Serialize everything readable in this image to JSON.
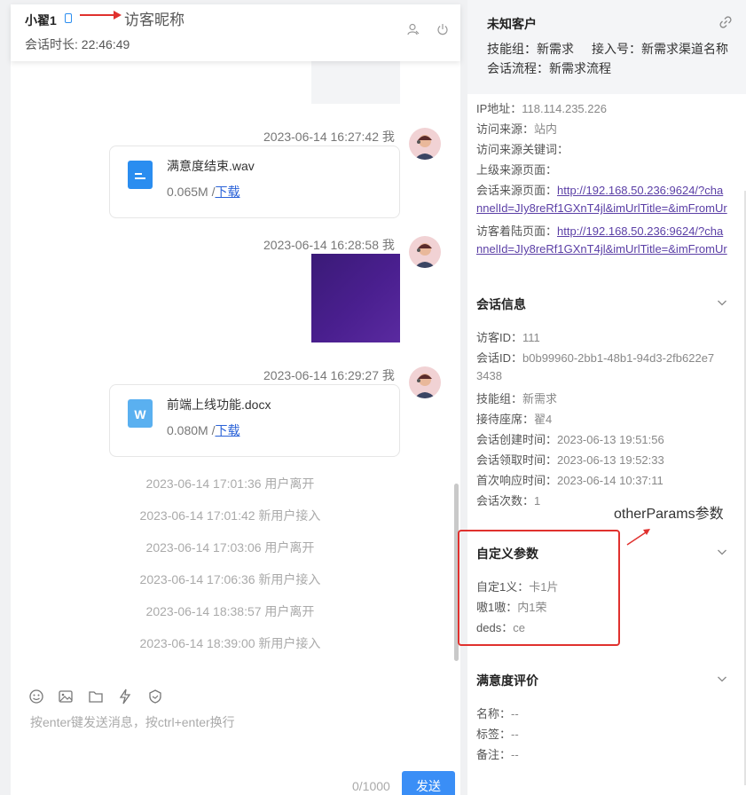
{
  "header": {
    "visitor_name": "小翟1",
    "annotation": "访客昵称",
    "duration": "会话时长: 22:46:49"
  },
  "messages": {
    "file1": {
      "timestamp": "2023-06-14 16:27:42 我",
      "name": "满意度结束.wav",
      "size": "0.065M /",
      "download": "下载"
    },
    "image1": {
      "timestamp": "2023-06-14 16:28:58 我"
    },
    "file2": {
      "timestamp": "2023-06-14 16:29:27 我",
      "name": "前端上线功能.docx",
      "size": "0.080M /",
      "download": "下载"
    },
    "system": [
      "2023-06-14 17:01:36 用户离开",
      "2023-06-14 17:01:42 新用户接入",
      "2023-06-14 17:03:06 用户离开",
      "2023-06-14 17:06:36 新用户接入",
      "2023-06-14 18:38:57 用户离开",
      "2023-06-14 18:39:00 新用户接入"
    ]
  },
  "input": {
    "placeholder": "按enter键发送消息，按ctrl+enter换行",
    "char_count": "0/1000",
    "send_label": "发送",
    "toolbar_icons": [
      "emoji-icon",
      "image-icon",
      "folder-icon",
      "lightning-icon",
      "shield-icon"
    ]
  },
  "customer": {
    "title": "未知客户",
    "skill_group_label": "技能组：",
    "skill_group": "新需求",
    "access_no_label": "接入号：",
    "access_no": "新需求渠道名称",
    "flow_label": "会话流程：",
    "flow": "新需求流程"
  },
  "visit": {
    "ip_label": "IP地址：",
    "ip": "118.114.235.226",
    "source_label": "访问来源：",
    "source": "站内",
    "keyword_label": "访问来源关键词：",
    "referrer_label": "上级来源页面：",
    "session_src_label": "会话来源页面：",
    "session_src_1": "http://192.168.50.236:9624/?cha",
    "session_src_2": "nnelId=JIy8reRf1GXnT4jl&imUrlTitle=&imFromUr",
    "landing_label": "访客着陆页面：",
    "landing_1": "http://192.168.50.236:9624/?cha",
    "landing_2": "nnelId=JIy8reRf1GXnT4jl&imUrlTitle=&imFromUr"
  },
  "session_info": {
    "title": "会话信息",
    "visitor_id_label": "访客ID：",
    "visitor_id": "111",
    "session_id_label": "会话ID：",
    "session_id_1": "b0b99960-2bb1-48b1-94d3-2fb622e7",
    "session_id_2": "3438",
    "skill_label": "技能组：",
    "skill": "新需求",
    "seat_label": "接待座席：",
    "seat": "翟4",
    "created_label": "会话创建时间：",
    "created": "2023-06-13 19:51:56",
    "claimed_label": "会话领取时间：",
    "claimed": "2023-06-13 19:52:33",
    "first_resp_label": "首次响应时间：",
    "first_resp": "2023-06-14 10:37:11",
    "count_label": "会话次数：",
    "count": "1"
  },
  "custom_params": {
    "title": "自定义参数",
    "annotation": "otherParams参数",
    "items": [
      {
        "label": "自定1义：",
        "value": "卡1片"
      },
      {
        "label": "嗷1嗷：",
        "value": "内1荣"
      },
      {
        "label": "deds：",
        "value": "ce"
      }
    ]
  },
  "satisfaction": {
    "title": "满意度评价",
    "name_label": "名称：",
    "name": "--",
    "tag_label": "标签：",
    "tag": "--",
    "note_label": "备注：",
    "note": "--"
  },
  "colors": {
    "accent": "#3a8ef6",
    "annotation_red": "#e0312e",
    "link_purple": "#5b3fa6"
  }
}
